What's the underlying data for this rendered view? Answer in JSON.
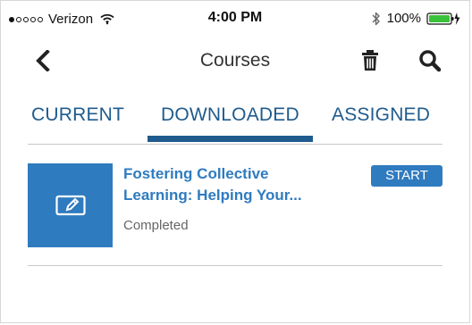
{
  "status_bar": {
    "carrier": "Verizon",
    "time": "4:00 PM",
    "battery": "100%",
    "signal_strength": 1,
    "icons": [
      "signal-dots",
      "wifi-icon",
      "bluetooth-icon",
      "battery-icon",
      "charging-icon"
    ]
  },
  "nav": {
    "title": "Courses",
    "icons": [
      "chevron-left-icon",
      "trash-icon",
      "search-icon"
    ]
  },
  "tabs": {
    "current": "CURRENT",
    "downloaded": "DOWNLOADED",
    "assigned": "ASSIGNED",
    "selected": "DOWNLOADED"
  },
  "course": {
    "title_line_1": "Fostering Collective",
    "title_line_2": "Learning: Helping Your...",
    "status": "Completed",
    "button_label": "START",
    "thumbnail_icon": "edit-document-icon"
  },
  "colors": {
    "accent": "#1f5b8d",
    "course_blue": "#2f7bbf",
    "divider": "#c9c9c9"
  }
}
